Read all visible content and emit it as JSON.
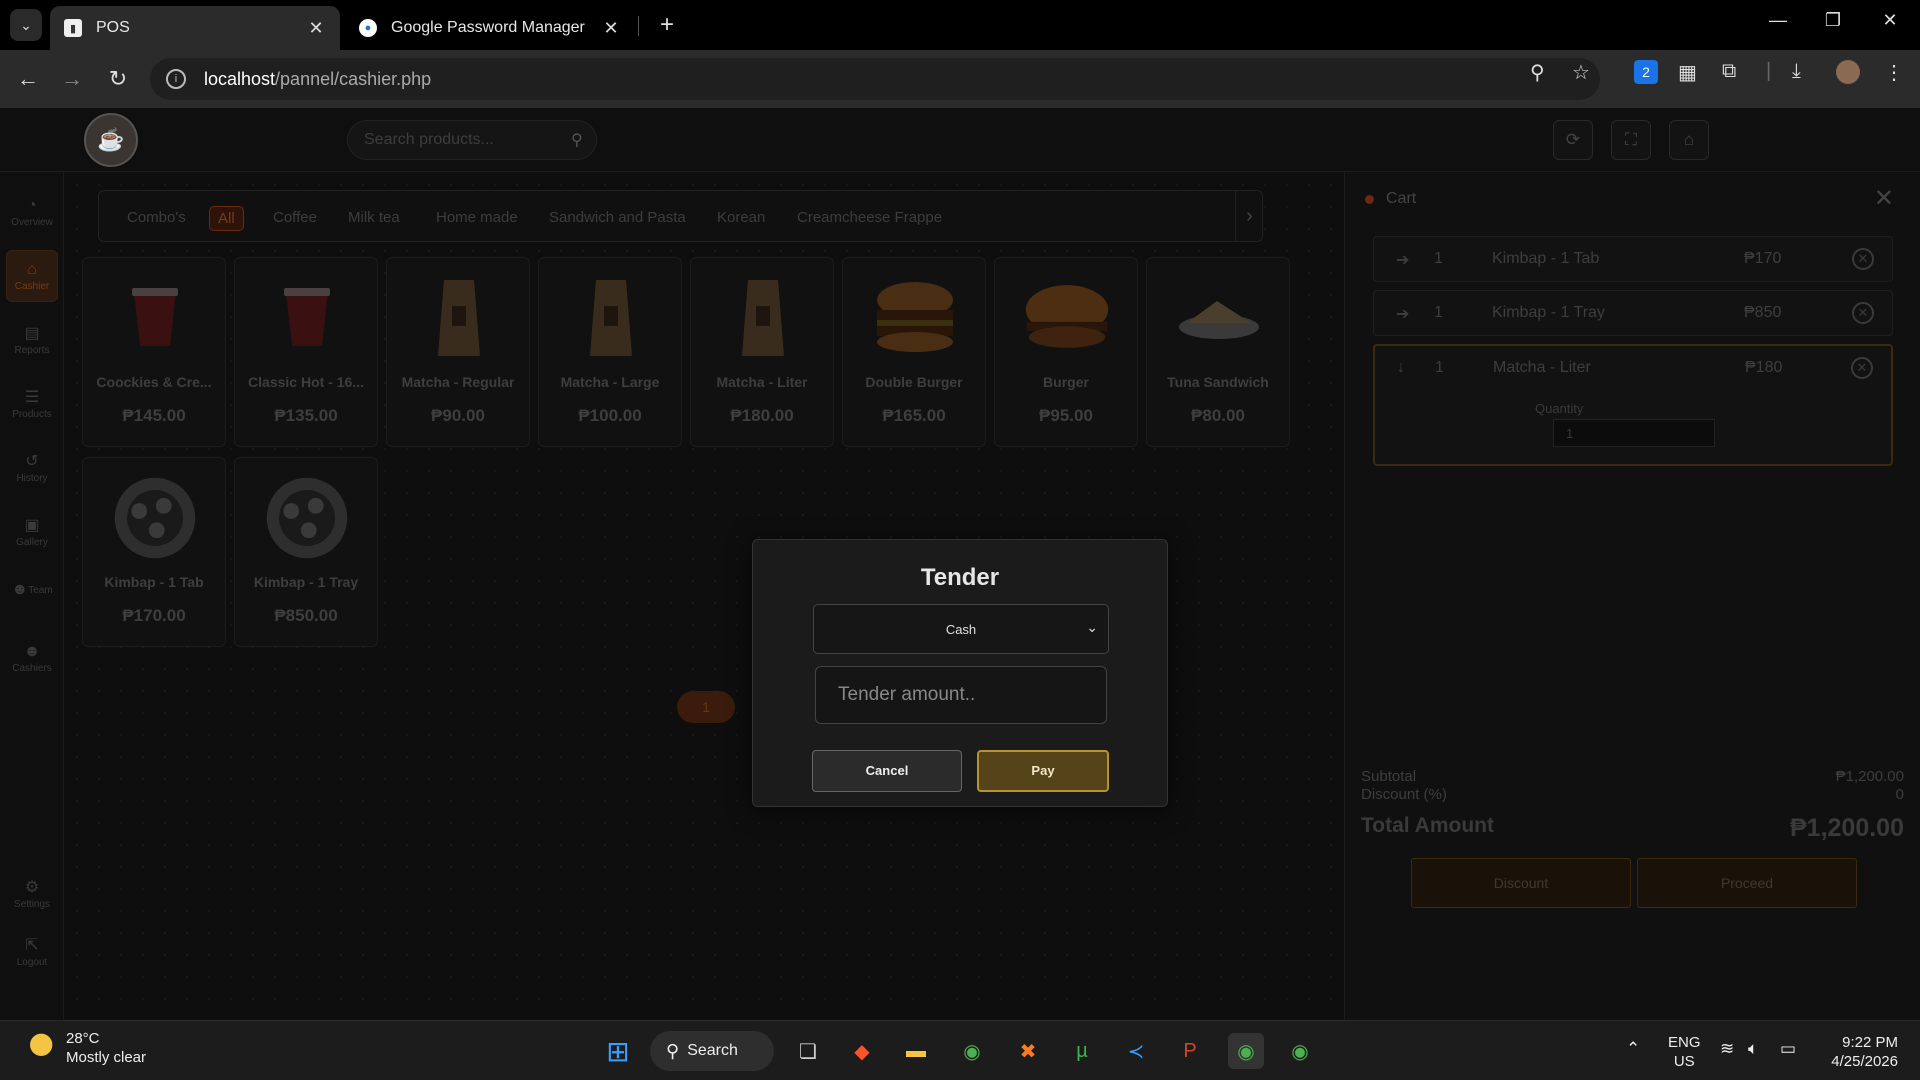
{
  "browser": {
    "tabs": [
      {
        "title": "POS",
        "active": true
      },
      {
        "title": "Google Password Manager",
        "active": false
      }
    ],
    "url_host": "localhost",
    "url_path": "/pannel/cashier.php"
  },
  "header": {
    "search_placeholder": "Search products..."
  },
  "sidebar": {
    "items": [
      {
        "label": "Overview",
        "icon": "pie-chart-icon",
        "active": false
      },
      {
        "label": "Cashier",
        "icon": "home-icon",
        "active": true
      },
      {
        "label": "Reports",
        "icon": "file-icon",
        "active": false
      },
      {
        "label": "Products",
        "icon": "stack-icon",
        "active": false
      },
      {
        "label": "History",
        "icon": "history-icon",
        "active": false
      },
      {
        "label": "Gallery",
        "icon": "image-icon",
        "active": false
      },
      {
        "label": "Team",
        "icon": "users-icon",
        "active": false
      },
      {
        "label": "Cashiers",
        "icon": "users-icon",
        "active": false
      },
      {
        "label": "Settings",
        "icon": "gear-icon",
        "active": false
      },
      {
        "label": "Logout",
        "icon": "external-link-icon",
        "active": false
      }
    ]
  },
  "categories": [
    "Combo's",
    "All",
    "Coffee",
    "Milk tea",
    "Home made",
    "Sandwich and Pasta",
    "Korean",
    "Creamcheese Frappe"
  ],
  "active_category": "All",
  "products": [
    {
      "name": "Coockies & Cre...",
      "price": "₱145.00",
      "icon": "coffee-cup-icon"
    },
    {
      "name": "Classic Hot - 16...",
      "price": "₱135.00",
      "icon": "coffee-cup-icon"
    },
    {
      "name": "Matcha - Regular",
      "price": "₱90.00",
      "icon": "drink-bag-icon"
    },
    {
      "name": "Matcha - Large",
      "price": "₱100.00",
      "icon": "drink-bag-icon"
    },
    {
      "name": "Matcha - Liter",
      "price": "₱180.00",
      "icon": "drink-bag-icon"
    },
    {
      "name": "Double Burger",
      "price": "₱165.00",
      "icon": "burger-icon"
    },
    {
      "name": "Burger",
      "price": "₱95.00",
      "icon": "burger-icon"
    },
    {
      "name": "Tuna Sandwich",
      "price": "₱80.00",
      "icon": "sandwich-icon"
    },
    {
      "name": "Kimbap - 1 Tab",
      "price": "₱170.00",
      "icon": "kimbap-icon"
    },
    {
      "name": "Kimbap - 1 Tray",
      "price": "₱850.00",
      "icon": "kimbap-icon"
    }
  ],
  "pagination": {
    "current": "1"
  },
  "cart": {
    "title": "Cart",
    "items": [
      {
        "qty": "1",
        "name": "Kimbap - 1 Tab",
        "price": "₱170",
        "expanded": false
      },
      {
        "qty": "1",
        "name": "Kimbap - 1 Tray",
        "price": "₱850",
        "expanded": false
      },
      {
        "qty": "1",
        "name": "Matcha - Liter",
        "price": "₱180",
        "expanded": true,
        "quantity_label": "Quantity",
        "quantity_value": "1"
      }
    ],
    "subtotal_label": "Subtotal",
    "subtotal": "₱1,200.00",
    "discount_label": "Discount (%)",
    "discount": "0",
    "total_label": "Total Amount",
    "total": "₱1,200.00",
    "discount_button": "Discount",
    "proceed_button": "Proceed"
  },
  "modal": {
    "title": "Tender",
    "payment_method": "Cash",
    "tender_placeholder": "Tender amount..",
    "cancel": "Cancel",
    "pay": "Pay"
  },
  "taskbar": {
    "temperature": "28°C",
    "weather": "Mostly clear",
    "search": "Search",
    "lang": "ENG",
    "region": "US",
    "time": "9:22 PM",
    "date": "4/25/2026"
  },
  "colors": {
    "accent": "#b8922e",
    "pay_bg": "#55431a",
    "active_nav": "#7a3a14"
  }
}
